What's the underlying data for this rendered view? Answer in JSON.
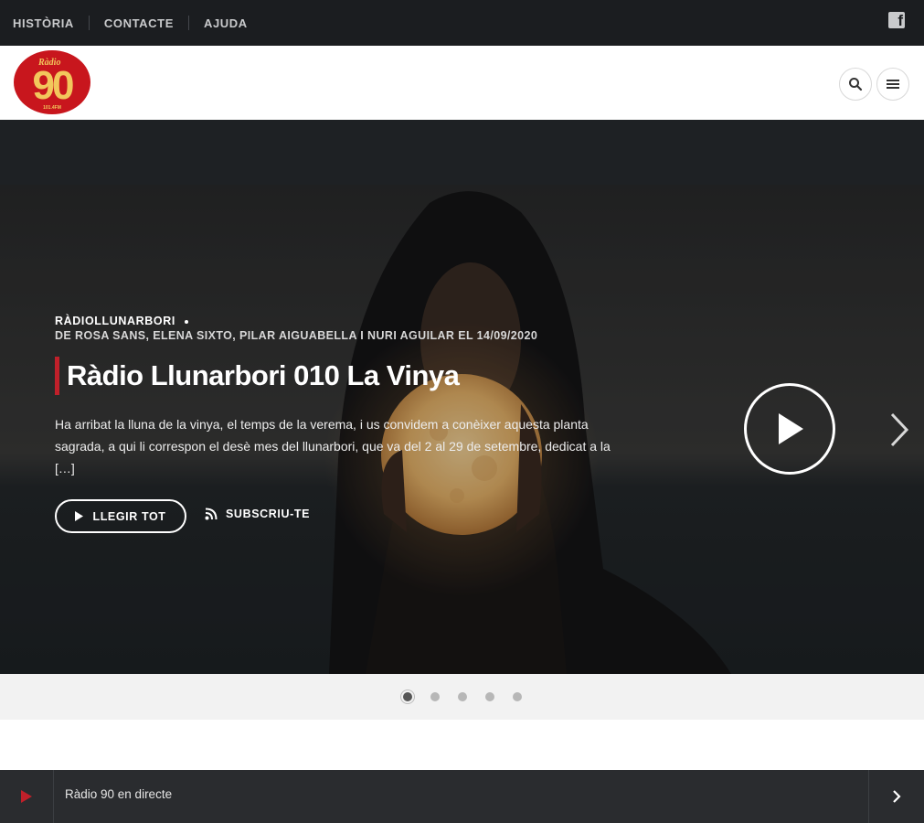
{
  "topnav": {
    "items": [
      {
        "label": "HISTÒRIA"
      },
      {
        "label": "CONTACTE"
      },
      {
        "label": "AJUDA"
      }
    ],
    "social_icon": "facebook-icon"
  },
  "header": {
    "logo": {
      "top_text": "Ràdio",
      "number": "90",
      "frequency": "101.4FM"
    },
    "search_icon": "search-icon",
    "menu_icon": "hamburger-menu-icon"
  },
  "hero": {
    "category": "RÀDIOLLUNARBORI",
    "byline": "DE ROSA SANS, ELENA SIXTO, PILAR AIGUABELLA I NURI AGUILAR EL 14/09/2020",
    "title": "Ràdio Llunarbori 010 La Vinya",
    "excerpt": "Ha arribat la lluna de la vinya, el temps de la verema, i us convidem a conèixer aquesta planta sagrada, a qui li correspon el desè mes del llunarbori, que va del 2 al 29 de setem­bre, dedicat a la […]",
    "read_more_label": "LLEGIR TOT",
    "subscribe_label": "SUBSCRIU-TE",
    "accent_color": "#c0202a"
  },
  "slider": {
    "dots": [
      {
        "active": true
      },
      {
        "active": false
      },
      {
        "active": false
      },
      {
        "active": false
      },
      {
        "active": false
      }
    ]
  },
  "player": {
    "label": "Ràdio 90 en directe",
    "play_color": "#c0202a"
  }
}
